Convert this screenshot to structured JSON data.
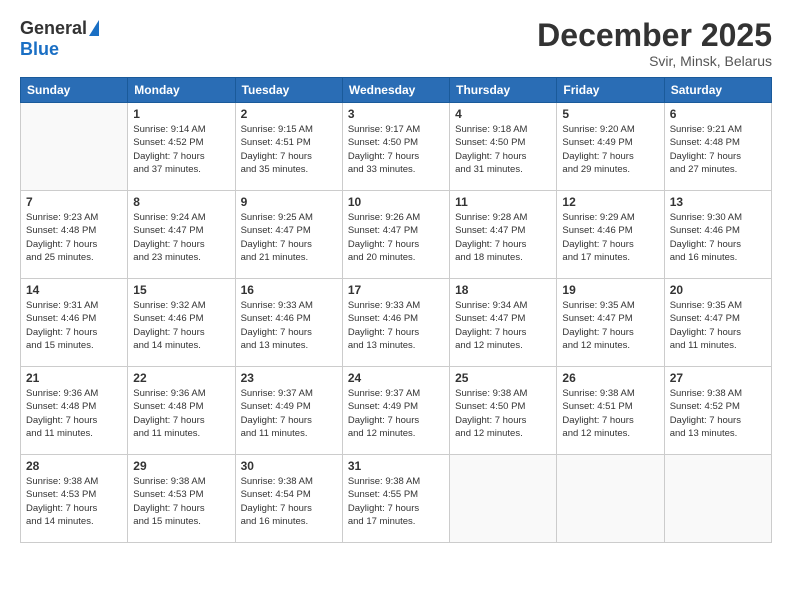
{
  "logo": {
    "general": "General",
    "blue": "Blue"
  },
  "title": "December 2025",
  "subtitle": "Svir, Minsk, Belarus",
  "weekdays": [
    "Sunday",
    "Monday",
    "Tuesday",
    "Wednesday",
    "Thursday",
    "Friday",
    "Saturday"
  ],
  "weeks": [
    [
      {
        "day": "",
        "info": ""
      },
      {
        "day": "1",
        "info": "Sunrise: 9:14 AM\nSunset: 4:52 PM\nDaylight: 7 hours\nand 37 minutes."
      },
      {
        "day": "2",
        "info": "Sunrise: 9:15 AM\nSunset: 4:51 PM\nDaylight: 7 hours\nand 35 minutes."
      },
      {
        "day": "3",
        "info": "Sunrise: 9:17 AM\nSunset: 4:50 PM\nDaylight: 7 hours\nand 33 minutes."
      },
      {
        "day": "4",
        "info": "Sunrise: 9:18 AM\nSunset: 4:50 PM\nDaylight: 7 hours\nand 31 minutes."
      },
      {
        "day": "5",
        "info": "Sunrise: 9:20 AM\nSunset: 4:49 PM\nDaylight: 7 hours\nand 29 minutes."
      },
      {
        "day": "6",
        "info": "Sunrise: 9:21 AM\nSunset: 4:48 PM\nDaylight: 7 hours\nand 27 minutes."
      }
    ],
    [
      {
        "day": "7",
        "info": "Sunrise: 9:23 AM\nSunset: 4:48 PM\nDaylight: 7 hours\nand 25 minutes."
      },
      {
        "day": "8",
        "info": "Sunrise: 9:24 AM\nSunset: 4:47 PM\nDaylight: 7 hours\nand 23 minutes."
      },
      {
        "day": "9",
        "info": "Sunrise: 9:25 AM\nSunset: 4:47 PM\nDaylight: 7 hours\nand 21 minutes."
      },
      {
        "day": "10",
        "info": "Sunrise: 9:26 AM\nSunset: 4:47 PM\nDaylight: 7 hours\nand 20 minutes."
      },
      {
        "day": "11",
        "info": "Sunrise: 9:28 AM\nSunset: 4:47 PM\nDaylight: 7 hours\nand 18 minutes."
      },
      {
        "day": "12",
        "info": "Sunrise: 9:29 AM\nSunset: 4:46 PM\nDaylight: 7 hours\nand 17 minutes."
      },
      {
        "day": "13",
        "info": "Sunrise: 9:30 AM\nSunset: 4:46 PM\nDaylight: 7 hours\nand 16 minutes."
      }
    ],
    [
      {
        "day": "14",
        "info": "Sunrise: 9:31 AM\nSunset: 4:46 PM\nDaylight: 7 hours\nand 15 minutes."
      },
      {
        "day": "15",
        "info": "Sunrise: 9:32 AM\nSunset: 4:46 PM\nDaylight: 7 hours\nand 14 minutes."
      },
      {
        "day": "16",
        "info": "Sunrise: 9:33 AM\nSunset: 4:46 PM\nDaylight: 7 hours\nand 13 minutes."
      },
      {
        "day": "17",
        "info": "Sunrise: 9:33 AM\nSunset: 4:46 PM\nDaylight: 7 hours\nand 13 minutes."
      },
      {
        "day": "18",
        "info": "Sunrise: 9:34 AM\nSunset: 4:47 PM\nDaylight: 7 hours\nand 12 minutes."
      },
      {
        "day": "19",
        "info": "Sunrise: 9:35 AM\nSunset: 4:47 PM\nDaylight: 7 hours\nand 12 minutes."
      },
      {
        "day": "20",
        "info": "Sunrise: 9:35 AM\nSunset: 4:47 PM\nDaylight: 7 hours\nand 11 minutes."
      }
    ],
    [
      {
        "day": "21",
        "info": "Sunrise: 9:36 AM\nSunset: 4:48 PM\nDaylight: 7 hours\nand 11 minutes."
      },
      {
        "day": "22",
        "info": "Sunrise: 9:36 AM\nSunset: 4:48 PM\nDaylight: 7 hours\nand 11 minutes."
      },
      {
        "day": "23",
        "info": "Sunrise: 9:37 AM\nSunset: 4:49 PM\nDaylight: 7 hours\nand 11 minutes."
      },
      {
        "day": "24",
        "info": "Sunrise: 9:37 AM\nSunset: 4:49 PM\nDaylight: 7 hours\nand 12 minutes."
      },
      {
        "day": "25",
        "info": "Sunrise: 9:38 AM\nSunset: 4:50 PM\nDaylight: 7 hours\nand 12 minutes."
      },
      {
        "day": "26",
        "info": "Sunrise: 9:38 AM\nSunset: 4:51 PM\nDaylight: 7 hours\nand 12 minutes."
      },
      {
        "day": "27",
        "info": "Sunrise: 9:38 AM\nSunset: 4:52 PM\nDaylight: 7 hours\nand 13 minutes."
      }
    ],
    [
      {
        "day": "28",
        "info": "Sunrise: 9:38 AM\nSunset: 4:53 PM\nDaylight: 7 hours\nand 14 minutes."
      },
      {
        "day": "29",
        "info": "Sunrise: 9:38 AM\nSunset: 4:53 PM\nDaylight: 7 hours\nand 15 minutes."
      },
      {
        "day": "30",
        "info": "Sunrise: 9:38 AM\nSunset: 4:54 PM\nDaylight: 7 hours\nand 16 minutes."
      },
      {
        "day": "31",
        "info": "Sunrise: 9:38 AM\nSunset: 4:55 PM\nDaylight: 7 hours\nand 17 minutes."
      },
      {
        "day": "",
        "info": ""
      },
      {
        "day": "",
        "info": ""
      },
      {
        "day": "",
        "info": ""
      }
    ]
  ]
}
